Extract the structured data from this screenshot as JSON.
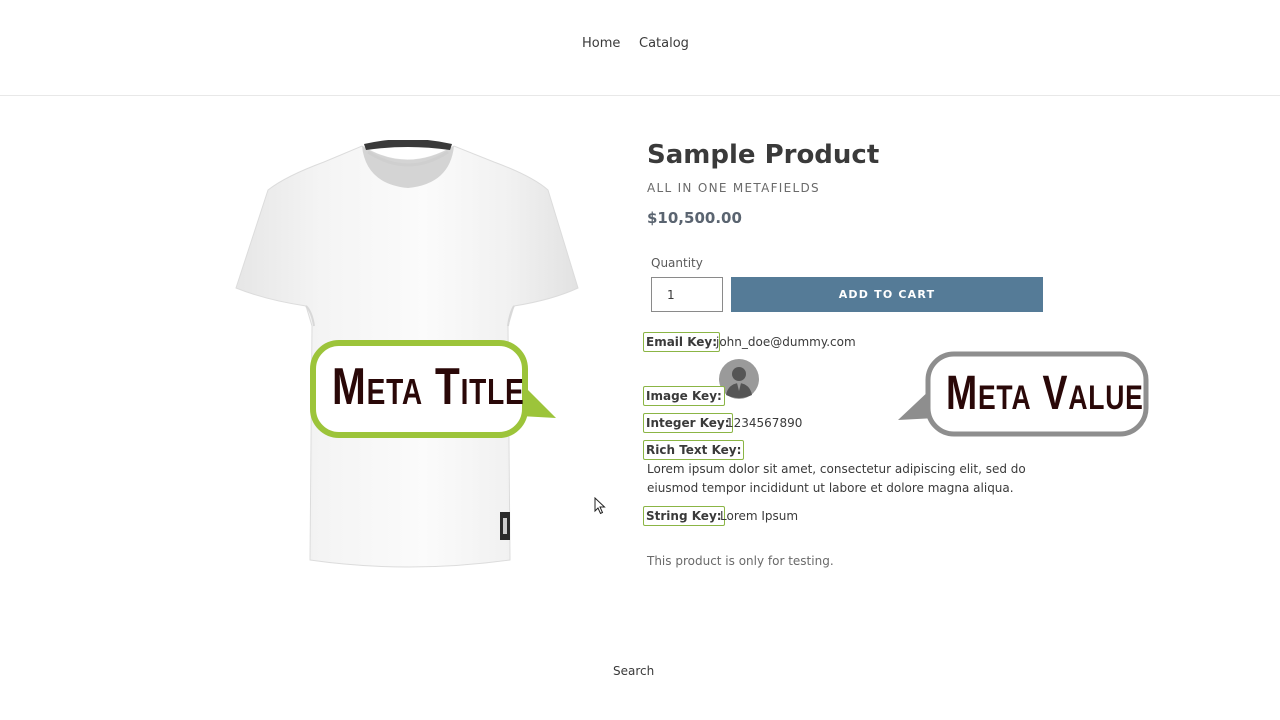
{
  "nav": {
    "home": "Home",
    "catalog": "Catalog"
  },
  "bubbles": {
    "title": "Meta Title",
    "value": "Meta Value"
  },
  "product": {
    "title": "Sample Product",
    "vendor": "ALL IN ONE METAFIELDS",
    "price": "$10,500.00",
    "quantity_label": "Quantity",
    "quantity_value": "1",
    "add_to_cart": "ADD TO CART",
    "description": "This product is only for testing."
  },
  "metafields": {
    "email_key": "Email Key:",
    "email_value": "john_doe@dummy.com",
    "image_key": "Image Key:",
    "integer_key": "Integer Key:",
    "integer_value": "1234567890",
    "rich_text_key": "Rich Text Key:",
    "rich_text_value": "Lorem ipsum dolor sit amet, consectetur adipiscing elit, sed do eiusmod tempor incididunt ut labore et dolore magna aliqua.",
    "string_key": "String Key:",
    "string_value": "Lorem Ipsum"
  },
  "footer": {
    "search": "Search"
  },
  "colors": {
    "button": "#557b97",
    "meta_key_border": "#8bb545",
    "bubble_green": "#9cc43a",
    "bubble_gray": "#8e8e8e"
  },
  "icons": [
    "avatar-icon",
    "cursor-icon"
  ]
}
